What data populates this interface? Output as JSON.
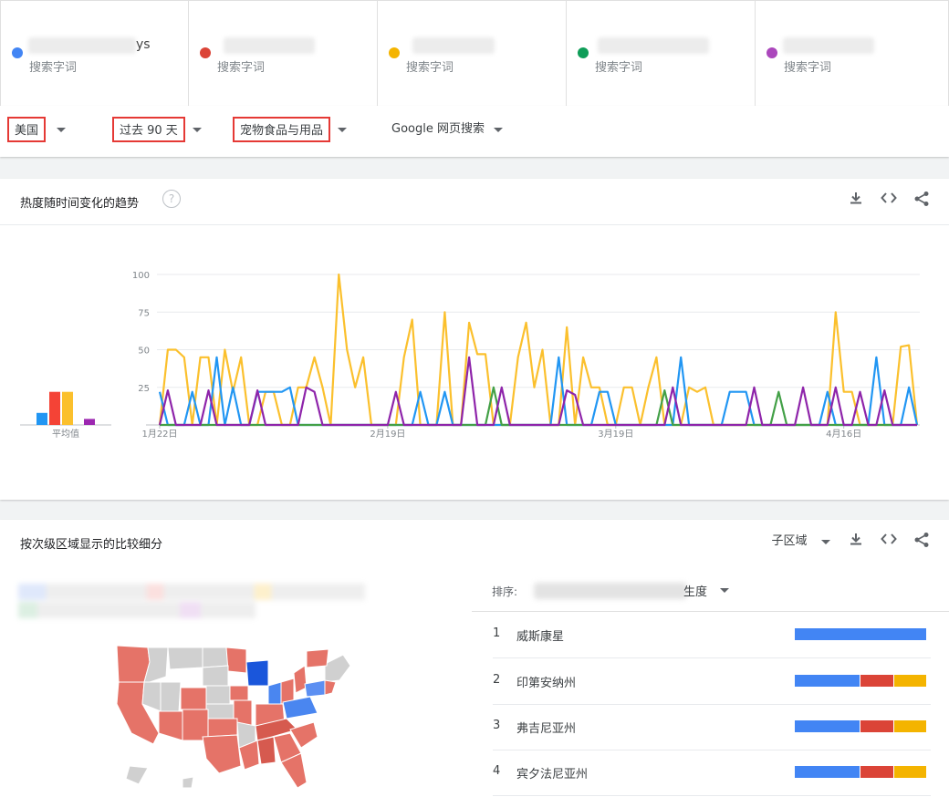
{
  "terms": [
    {
      "color": "#4285f4",
      "tail": "ys",
      "sub": "搜索字词"
    },
    {
      "color": "#db4437",
      "tail": "",
      "sub": "搜索字词"
    },
    {
      "color": "#f4b400",
      "tail": "",
      "sub": "搜索字词"
    },
    {
      "color": "#0f9d58",
      "tail": "",
      "sub": "搜索字词"
    },
    {
      "color": "#ab47bc",
      "tail": "",
      "sub": "搜索字词"
    }
  ],
  "filters": {
    "region": "美国",
    "time": "过去 90 天",
    "category": "宠物食品与用品",
    "search_type": "Google 网页搜索"
  },
  "trend": {
    "title": "热度随时间变化的趋势",
    "help": "?",
    "avg_label": "平均值"
  },
  "chart_data": {
    "type": "line",
    "ylim": [
      0,
      100
    ],
    "yticks": [
      25,
      50,
      75,
      100
    ],
    "xtick_labels": [
      {
        "i": 0,
        "label": "1月22日"
      },
      {
        "i": 28,
        "label": "2月19日"
      },
      {
        "i": 56,
        "label": "3月19日"
      },
      {
        "i": 84,
        "label": "4月16日"
      }
    ],
    "averages": [
      {
        "name": "blue",
        "color": "#2196f3",
        "value": 8
      },
      {
        "name": "red",
        "color": "#f44336",
        "value": 22
      },
      {
        "name": "yellow",
        "color": "#fbc02d",
        "value": 22
      },
      {
        "name": "purple",
        "color": "#9c27b0",
        "value": 4
      }
    ],
    "series": [
      {
        "color": "#fbc02d",
        "values": [
          0,
          50,
          50,
          45,
          0,
          45,
          45,
          0,
          50,
          22,
          45,
          0,
          0,
          22,
          22,
          0,
          0,
          25,
          25,
          45,
          25,
          0,
          100,
          50,
          25,
          45,
          0,
          0,
          0,
          0,
          45,
          70,
          0,
          0,
          0,
          75,
          0,
          0,
          68,
          47,
          47,
          0,
          0,
          0,
          45,
          68,
          25,
          50,
          0,
          0,
          65,
          0,
          45,
          25,
          25,
          0,
          0,
          25,
          25,
          0,
          25,
          45,
          0,
          0,
          0,
          25,
          22,
          25,
          0,
          0,
          0,
          0,
          0,
          0,
          0,
          0,
          0,
          0,
          0,
          0,
          0,
          0,
          0,
          75,
          22,
          22,
          0,
          0,
          0,
          0,
          0,
          52,
          53,
          0
        ]
      },
      {
        "color": "#2196f3",
        "values": [
          22,
          0,
          0,
          0,
          22,
          0,
          0,
          45,
          0,
          25,
          0,
          0,
          22,
          22,
          22,
          22,
          25,
          0,
          0,
          0,
          0,
          0,
          0,
          0,
          0,
          0,
          0,
          0,
          0,
          0,
          0,
          0,
          22,
          0,
          0,
          22,
          0,
          0,
          0,
          0,
          0,
          0,
          0,
          0,
          0,
          0,
          0,
          0,
          0,
          45,
          0,
          0,
          0,
          0,
          22,
          22,
          0,
          0,
          0,
          0,
          0,
          0,
          0,
          0,
          45,
          0,
          0,
          0,
          0,
          0,
          22,
          22,
          22,
          0,
          0,
          0,
          0,
          0,
          0,
          0,
          0,
          0,
          22,
          0,
          0,
          0,
          0,
          0,
          45,
          0,
          0,
          0,
          25,
          0
        ]
      },
      {
        "color": "#43a047",
        "values": [
          0,
          0,
          0,
          0,
          0,
          0,
          0,
          0,
          0,
          0,
          0,
          0,
          0,
          0,
          0,
          0,
          0,
          0,
          0,
          0,
          0,
          0,
          0,
          0,
          0,
          0,
          0,
          0,
          0,
          0,
          0,
          0,
          0,
          0,
          0,
          0,
          0,
          0,
          0,
          0,
          0,
          25,
          0,
          0,
          0,
          0,
          0,
          0,
          0,
          0,
          0,
          0,
          0,
          0,
          0,
          0,
          0,
          0,
          0,
          0,
          0,
          0,
          23,
          0,
          0,
          0,
          0,
          0,
          0,
          0,
          0,
          0,
          0,
          0,
          0,
          0,
          22,
          0,
          0,
          0,
          0,
          0,
          0,
          0,
          0,
          0,
          0,
          0,
          0,
          0,
          0,
          0,
          0,
          0
        ]
      },
      {
        "color": "#8e24aa",
        "values": [
          0,
          23,
          0,
          0,
          0,
          0,
          23,
          0,
          0,
          0,
          0,
          0,
          23,
          0,
          0,
          0,
          0,
          0,
          25,
          22,
          0,
          0,
          0,
          0,
          0,
          0,
          0,
          0,
          0,
          22,
          0,
          0,
          0,
          0,
          0,
          0,
          0,
          0,
          45,
          0,
          0,
          0,
          25,
          0,
          0,
          0,
          0,
          0,
          0,
          0,
          23,
          20,
          0,
          0,
          0,
          0,
          0,
          0,
          0,
          0,
          0,
          0,
          0,
          25,
          0,
          0,
          0,
          0,
          0,
          0,
          0,
          0,
          0,
          25,
          0,
          0,
          0,
          0,
          0,
          25,
          0,
          0,
          0,
          25,
          0,
          0,
          22,
          0,
          0,
          23,
          0,
          0,
          0,
          0
        ]
      }
    ]
  },
  "regions": {
    "title": "按次级区域显示的比较细分",
    "sub_region": "子区域",
    "sort_label": "排序:",
    "sort_tail": "生度",
    "rows": [
      {
        "rank": "1",
        "name": "威斯康星",
        "shares": [
          1.0,
          0,
          0
        ]
      },
      {
        "rank": "2",
        "name": "印第安纳州",
        "shares": [
          0.5,
          0.25,
          0.25
        ]
      },
      {
        "rank": "3",
        "name": "弗吉尼亚州",
        "shares": [
          0.5,
          0.25,
          0.25
        ]
      },
      {
        "rank": "4",
        "name": "宾夕法尼亚州",
        "shares": [
          0.5,
          0.25,
          0.25
        ]
      }
    ],
    "bar_colors": [
      "#4285f4",
      "#db4437",
      "#f4b400"
    ]
  },
  "icons": {
    "download": "download-icon",
    "embed": "embed-icon",
    "share": "share-icon"
  }
}
